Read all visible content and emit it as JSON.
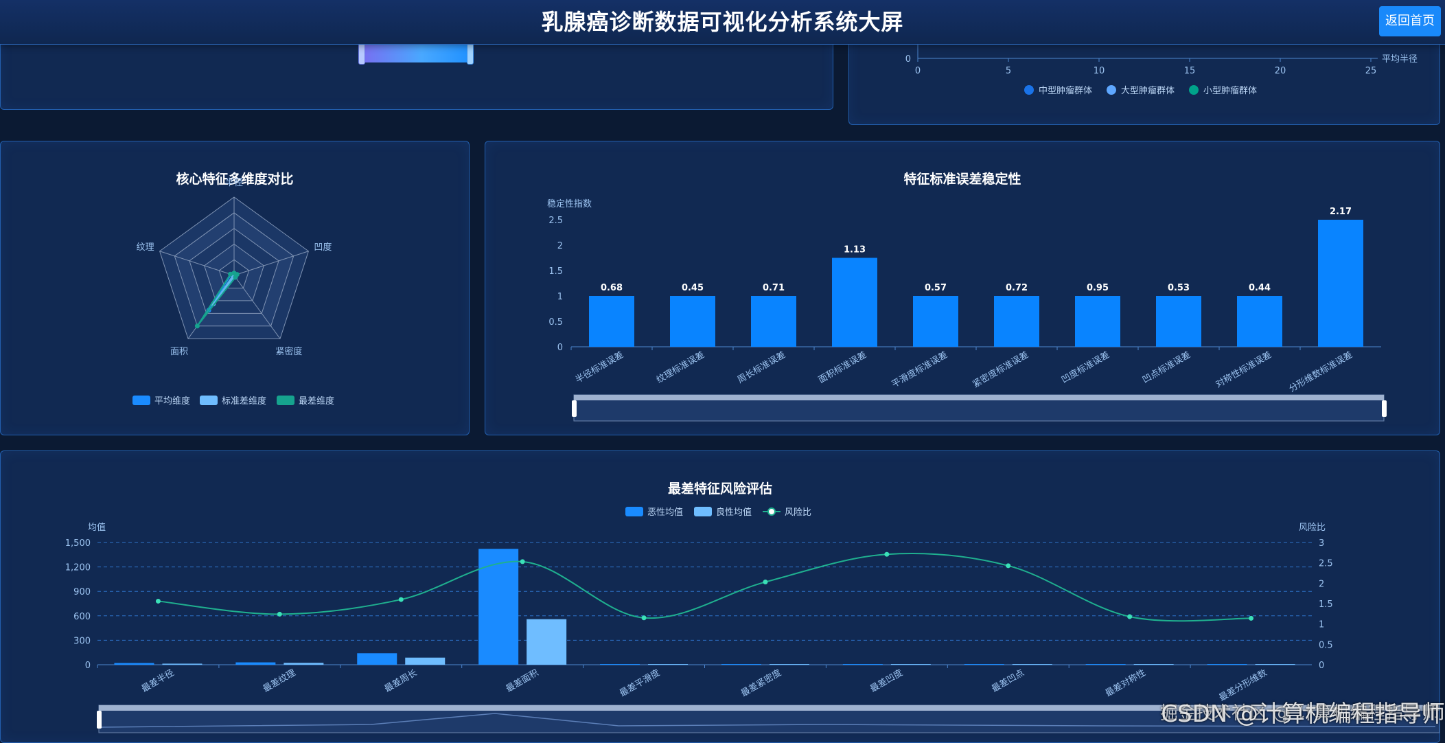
{
  "header": {
    "title": "乳腺癌诊断数据可视化分析系统大屏",
    "back_button": "返回首页"
  },
  "top_right_panel": {
    "x_ticks": [
      "0",
      "5",
      "10",
      "15",
      "20",
      "25"
    ],
    "y_tick": "0",
    "x_axis_name": "平均半径",
    "legend": [
      {
        "label": "中型肿瘤群体",
        "color": "#1a73e8"
      },
      {
        "label": "大型肿瘤群体",
        "color": "#5ea7ff"
      },
      {
        "label": "小型肿瘤群体",
        "color": "#00a38a"
      }
    ]
  },
  "radar_panel": {
    "title": "核心特征多维度对比",
    "indicators": [
      "半径",
      "凹度",
      "紧密度",
      "面积",
      "纹理"
    ],
    "legend": [
      {
        "label": "平均维度",
        "color": "#1a8bff"
      },
      {
        "label": "标准差维度",
        "color": "#6fbdff"
      },
      {
        "label": "最差维度",
        "color": "#16a38e"
      }
    ]
  },
  "stability_panel": {
    "title": "特征标准误差稳定性",
    "y_axis_name": "稳定性指数",
    "y_ticks": [
      "0",
      "0.5",
      "1",
      "1.5",
      "2",
      "2.5"
    ],
    "categories": [
      "半径标准误差",
      "纹理标准误差",
      "周长标准误差",
      "面积标准误差",
      "平滑度标准误差",
      "紧密度标准误差",
      "凹度标准误差",
      "凹点标准误差",
      "对称性标准误差",
      "分形维数标准误差"
    ],
    "bar_labels": [
      "0.68",
      "0.45",
      "0.71",
      "1.13",
      "0.57",
      "0.72",
      "0.95",
      "0.53",
      "0.44",
      "2.17"
    ]
  },
  "risk_panel": {
    "title": "最差特征风险评估",
    "left_axis_name": "均值",
    "right_axis_name": "风险比",
    "left_ticks": [
      "0",
      "300",
      "600",
      "900",
      "1,200",
      "1,500"
    ],
    "right_ticks": [
      "0",
      "0.5",
      "1",
      "1.5",
      "2",
      "2.5",
      "3"
    ],
    "legend": [
      {
        "label": "恶性均值",
        "color": "#1a8bff"
      },
      {
        "label": "良性均值",
        "color": "#6fbdff"
      },
      {
        "label": "风险比",
        "color": "#1fb08f"
      }
    ],
    "categories": [
      "最差半径",
      "最差纹理",
      "最差周长",
      "最差面积",
      "最差平滑度",
      "最差紧密度",
      "最差凹度",
      "最差凹点",
      "最差对称性",
      "最差分形维数"
    ]
  },
  "chart_data": [
    {
      "type": "scatter",
      "xlabel": "平均半径",
      "xlim": [
        0,
        25
      ],
      "series": [
        {
          "name": "中型肿瘤群体",
          "values": []
        },
        {
          "name": "大型肿瘤群体",
          "values": []
        },
        {
          "name": "小型肿瘤群体",
          "values": []
        }
      ]
    },
    {
      "type": "radar",
      "title": "核心特征多维度对比",
      "indicators": [
        "半径",
        "凹度",
        "紧密度",
        "面积",
        "纹理"
      ],
      "max": 1,
      "series": [
        {
          "name": "平均维度",
          "values": [
            0.02,
            0.03,
            0.03,
            0.55,
            0.04
          ]
        },
        {
          "name": "标准差维度",
          "values": [
            0.01,
            0.01,
            0.01,
            0.45,
            0.01
          ]
        },
        {
          "name": "最差维度",
          "values": [
            0.03,
            0.04,
            0.03,
            0.8,
            0.05
          ]
        }
      ]
    },
    {
      "type": "bar",
      "title": "特征标准误差稳定性",
      "ylabel": "稳定性指数",
      "ylim": [
        0,
        2.5
      ],
      "categories": [
        "半径标准误差",
        "纹理标准误差",
        "周长标准误差",
        "面积标准误差",
        "平滑度标准误差",
        "紧密度标准误差",
        "凹度标准误差",
        "凹点标准误差",
        "对称性标准误差",
        "分形维数标准误差"
      ],
      "values": [
        1.0,
        1.0,
        1.0,
        1.75,
        1.0,
        1.0,
        1.0,
        1.0,
        1.0,
        2.5
      ],
      "labels": [
        "0.68",
        "0.45",
        "0.71",
        "1.13",
        "0.57",
        "0.72",
        "0.95",
        "0.53",
        "0.44",
        "2.17"
      ]
    },
    {
      "type": "bar",
      "title": "最差特征风险评估",
      "ylabel": "均值",
      "ylim": [
        0,
        1500
      ],
      "y2label": "风险比",
      "y2lim": [
        0,
        3
      ],
      "categories": [
        "最差半径",
        "最差纹理",
        "最差周长",
        "最差面积",
        "最差平滑度",
        "最差紧密度",
        "最差凹度",
        "最差凹点",
        "最差对称性",
        "最差分形维数"
      ],
      "series": [
        {
          "name": "恶性均值",
          "type": "bar",
          "values": [
            21,
            29,
            141,
            1422,
            0.15,
            0.54,
            0.61,
            0.18,
            0.32,
            0.09
          ]
        },
        {
          "name": "良性均值",
          "type": "bar",
          "values": [
            13,
            23,
            87,
            559,
            0.12,
            0.18,
            0.17,
            0.07,
            0.27,
            0.08
          ]
        },
        {
          "name": "风险比",
          "type": "line",
          "axis": "right",
          "values": [
            1.56,
            1.24,
            1.6,
            2.53,
            1.15,
            2.03,
            2.71,
            2.43,
            1.18,
            1.14
          ]
        }
      ]
    }
  ],
  "watermark": {
    "main": "CSDN @计算机编程指导师",
    "sub": "掘金技术社区 @ 计算机编程指导师"
  }
}
